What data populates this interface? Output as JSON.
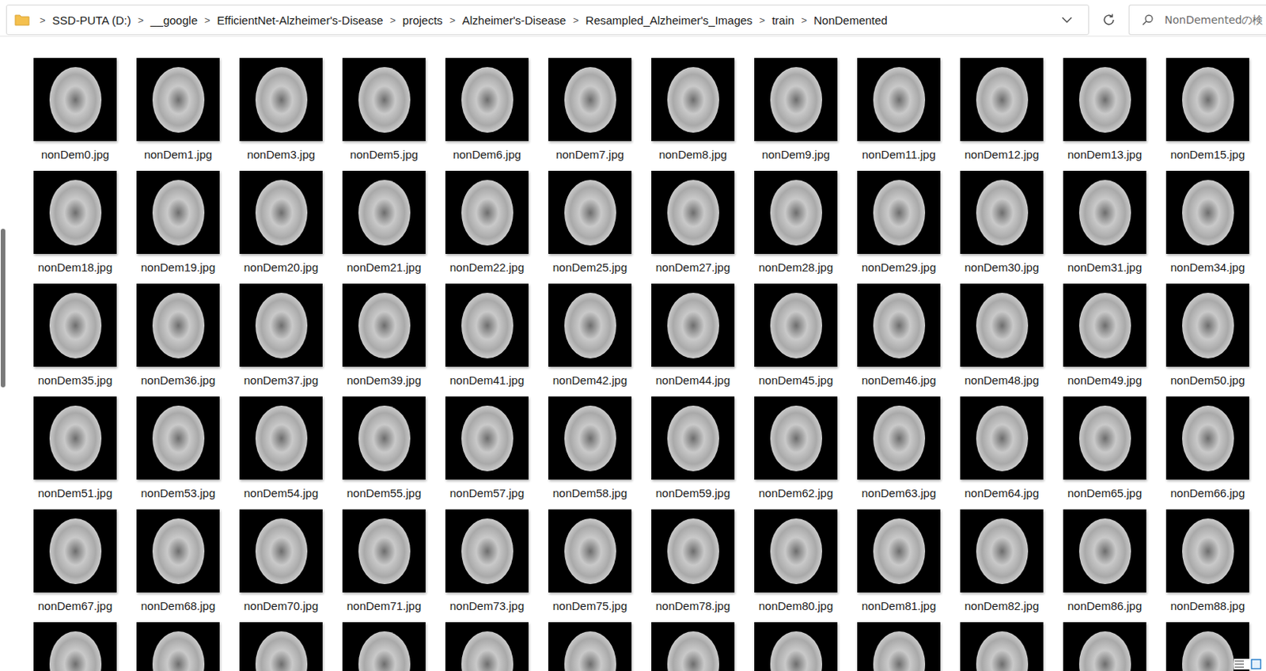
{
  "window": {
    "title": "NonDemented"
  },
  "address_bar": {
    "separator": ">",
    "breadcrumbs": [
      "SSD-PUTA (D:)",
      "__google",
      "EfficientNet-Alzheimer's-Disease",
      "projects",
      "Alzheimer's-Disease",
      "Resampled_Alzheimer's_Images",
      "train",
      "NonDemented"
    ]
  },
  "search": {
    "placeholder": "NonDementedの検"
  },
  "files": [
    {
      "name": "nonDem0.jpg"
    },
    {
      "name": "nonDem1.jpg"
    },
    {
      "name": "nonDem3.jpg"
    },
    {
      "name": "nonDem5.jpg"
    },
    {
      "name": "nonDem6.jpg"
    },
    {
      "name": "nonDem7.jpg"
    },
    {
      "name": "nonDem8.jpg"
    },
    {
      "name": "nonDem9.jpg"
    },
    {
      "name": "nonDem11.jpg"
    },
    {
      "name": "nonDem12.jpg"
    },
    {
      "name": "nonDem13.jpg"
    },
    {
      "name": "nonDem15.jpg"
    },
    {
      "name": "nonDem18.jpg"
    },
    {
      "name": "nonDem19.jpg"
    },
    {
      "name": "nonDem20.jpg"
    },
    {
      "name": "nonDem21.jpg"
    },
    {
      "name": "nonDem22.jpg"
    },
    {
      "name": "nonDem25.jpg"
    },
    {
      "name": "nonDem27.jpg"
    },
    {
      "name": "nonDem28.jpg"
    },
    {
      "name": "nonDem29.jpg"
    },
    {
      "name": "nonDem30.jpg"
    },
    {
      "name": "nonDem31.jpg"
    },
    {
      "name": "nonDem34.jpg"
    },
    {
      "name": "nonDem35.jpg"
    },
    {
      "name": "nonDem36.jpg"
    },
    {
      "name": "nonDem37.jpg"
    },
    {
      "name": "nonDem39.jpg"
    },
    {
      "name": "nonDem41.jpg"
    },
    {
      "name": "nonDem42.jpg"
    },
    {
      "name": "nonDem44.jpg"
    },
    {
      "name": "nonDem45.jpg"
    },
    {
      "name": "nonDem46.jpg"
    },
    {
      "name": "nonDem48.jpg"
    },
    {
      "name": "nonDem49.jpg"
    },
    {
      "name": "nonDem50.jpg"
    },
    {
      "name": "nonDem51.jpg"
    },
    {
      "name": "nonDem53.jpg"
    },
    {
      "name": "nonDem54.jpg"
    },
    {
      "name": "nonDem55.jpg"
    },
    {
      "name": "nonDem57.jpg"
    },
    {
      "name": "nonDem58.jpg"
    },
    {
      "name": "nonDem59.jpg"
    },
    {
      "name": "nonDem62.jpg"
    },
    {
      "name": "nonDem63.jpg"
    },
    {
      "name": "nonDem64.jpg"
    },
    {
      "name": "nonDem65.jpg"
    },
    {
      "name": "nonDem66.jpg"
    },
    {
      "name": "nonDem67.jpg"
    },
    {
      "name": "nonDem68.jpg"
    },
    {
      "name": "nonDem70.jpg"
    },
    {
      "name": "nonDem71.jpg"
    },
    {
      "name": "nonDem73.jpg"
    },
    {
      "name": "nonDem75.jpg"
    },
    {
      "name": "nonDem78.jpg"
    },
    {
      "name": "nonDem80.jpg"
    },
    {
      "name": "nonDem81.jpg"
    },
    {
      "name": "nonDem82.jpg"
    },
    {
      "name": "nonDem86.jpg"
    },
    {
      "name": "nonDem88.jpg"
    },
    {
      "name": ""
    },
    {
      "name": ""
    },
    {
      "name": ""
    },
    {
      "name": ""
    },
    {
      "name": ""
    },
    {
      "name": ""
    },
    {
      "name": ""
    },
    {
      "name": ""
    },
    {
      "name": ""
    },
    {
      "name": ""
    },
    {
      "name": ""
    },
    {
      "name": ""
    }
  ]
}
